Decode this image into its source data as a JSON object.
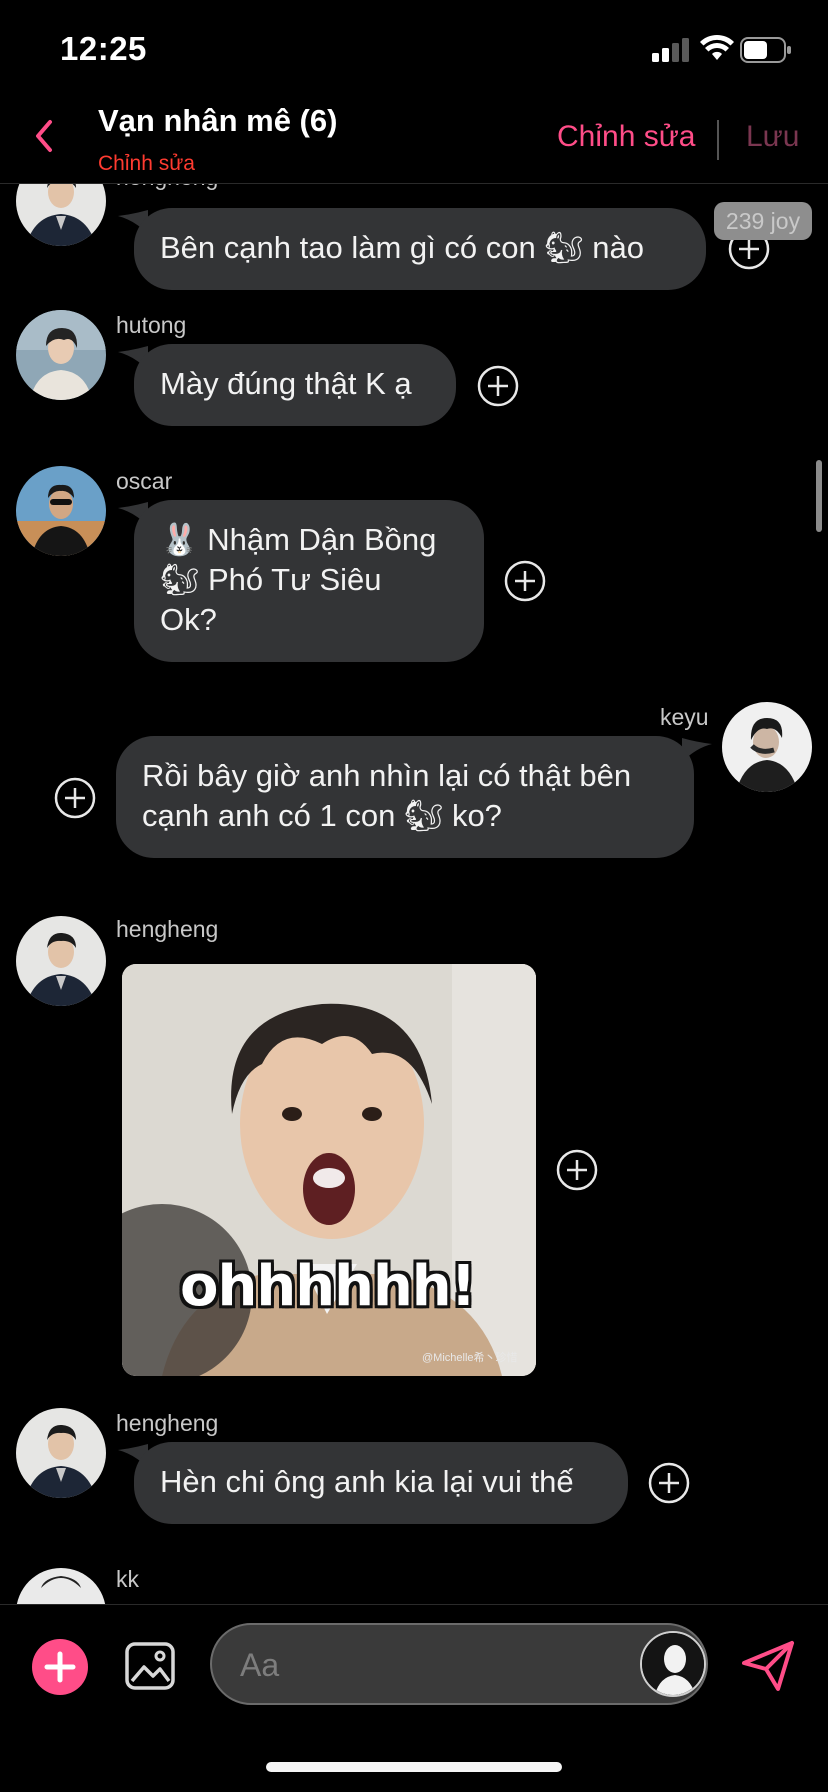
{
  "status": {
    "time": "12:25"
  },
  "header": {
    "title": "Vạn nhân mê (6)",
    "subtitle": "Chỉnh sửa",
    "edit_label": "Chỉnh sửa",
    "save_label": "Lưu"
  },
  "joy_badge": "239 joy",
  "messages": [
    {
      "sender": "hengheng",
      "text": "Bên cạnh tao làm gì có con 🐿 nào"
    },
    {
      "sender": "hutong",
      "text": "Mày đúng thật K ạ"
    },
    {
      "sender": "oscar",
      "lines": [
        "🐰 Nhậm Dận Bồng",
        "🐿 Phó Tư Siêu",
        "Ok?"
      ]
    },
    {
      "sender": "keyu",
      "lines": [
        "Rồi bây giờ anh nhìn lại có thật bên",
        "cạnh anh có 1 con 🐿 ko?"
      ]
    },
    {
      "sender": "hengheng",
      "image_caption": "ohhhhhh!",
      "image_watermark": "@Michelle希丶珍惜"
    },
    {
      "sender": "hengheng",
      "text": "Hèn chi ông anh kia lại vui thế"
    },
    {
      "sender": "kk"
    }
  ],
  "composer": {
    "placeholder": "Aa"
  },
  "colors": {
    "accent": "#ff4d88",
    "alert": "#ff3b30",
    "bubble": "#333436"
  }
}
